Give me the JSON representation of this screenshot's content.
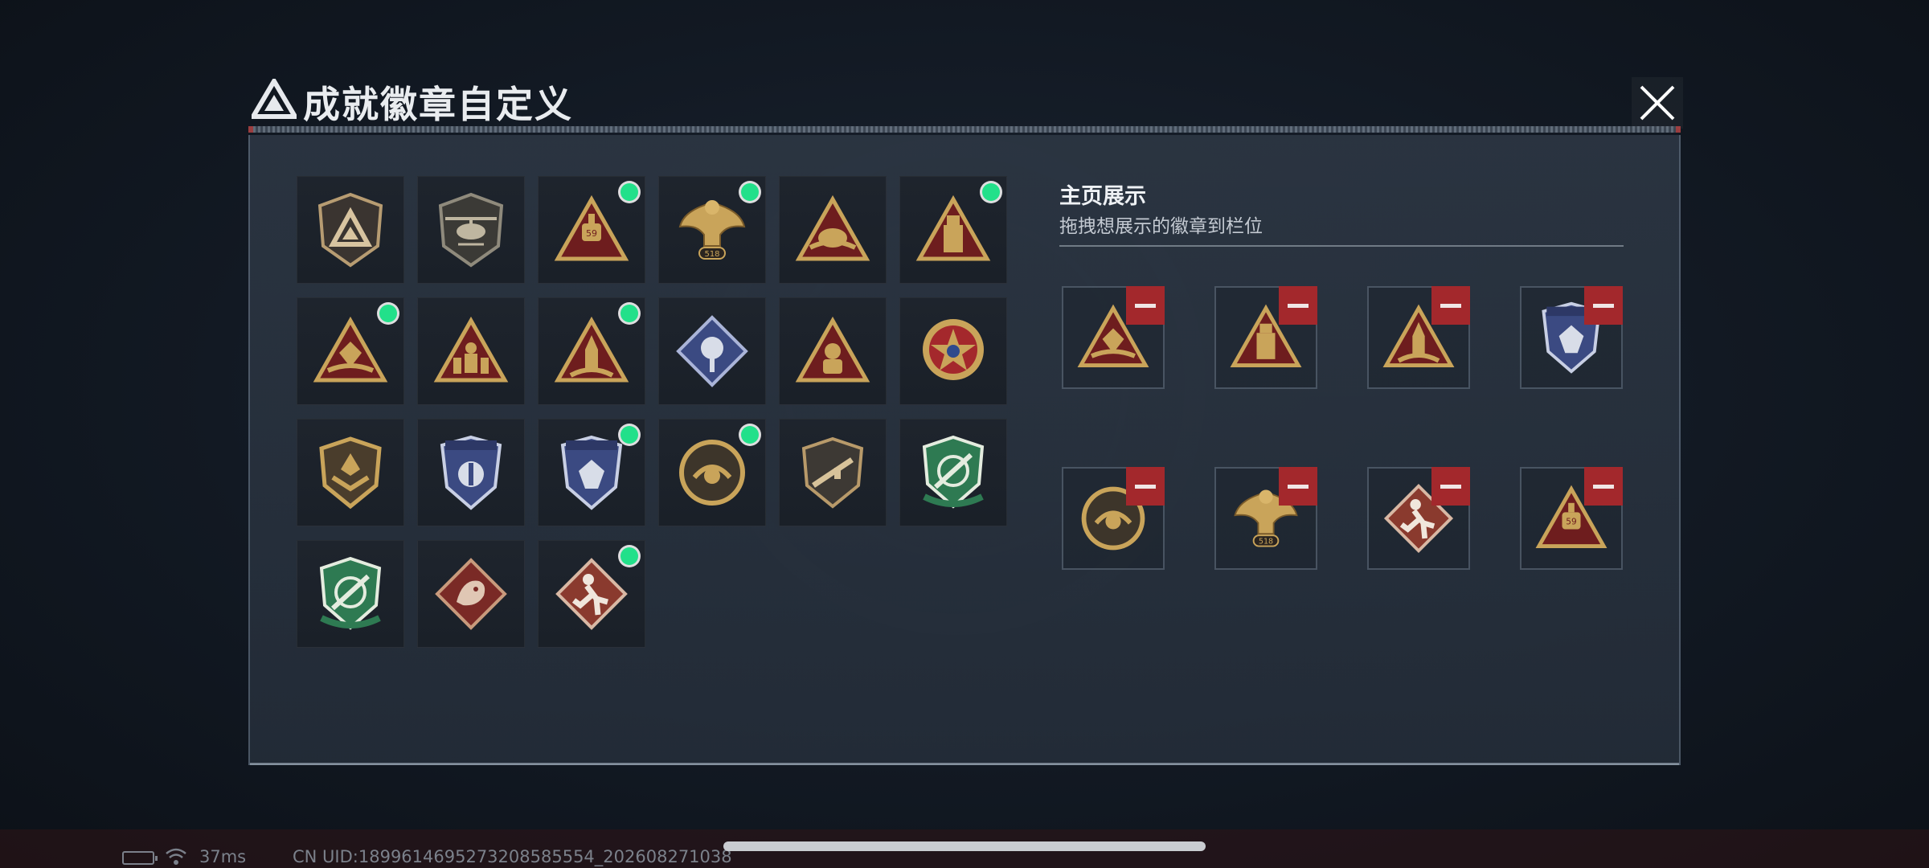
{
  "dialog": {
    "title": "成就徽章自定义",
    "logo_icon": "triangle-logo-icon",
    "close_icon": "close-icon"
  },
  "badges": [
    {
      "icon": "shield-triangle-badge-icon",
      "is_new": false
    },
    {
      "icon": "helicopter-badge-icon",
      "is_new": false
    },
    {
      "icon": "gold-triangle-59-badge-icon",
      "is_new": true
    },
    {
      "icon": "phoenix-518-badge-icon",
      "is_new": true
    },
    {
      "icon": "gold-triangle-hands-badge-icon",
      "is_new": false
    },
    {
      "icon": "gold-triangle-usb-badge-icon",
      "is_new": true
    },
    {
      "icon": "gold-triangle-crystal-badge-icon",
      "is_new": true
    },
    {
      "icon": "gold-triangle-soldiers-badge-icon",
      "is_new": false
    },
    {
      "icon": "gold-triangle-rocket-badge-icon",
      "is_new": true
    },
    {
      "icon": "blue-diamond-rose-badge-icon",
      "is_new": false
    },
    {
      "icon": "gold-triangle-astronaut-badge-icon",
      "is_new": false
    },
    {
      "icon": "red-star-medal-badge-icon",
      "is_new": false
    },
    {
      "icon": "gold-shield-chevron-badge-icon",
      "is_new": false
    },
    {
      "icon": "blue-shield-emblem-badge-icon",
      "is_new": false
    },
    {
      "icon": "blue-shield-crystal-badge-icon",
      "is_new": true
    },
    {
      "icon": "gold-round-pearl-badge-icon",
      "is_new": true
    },
    {
      "icon": "gold-shield-rifle-badge-icon",
      "is_new": false
    },
    {
      "icon": "green-shield-sniper-badge-icon",
      "is_new": false
    },
    {
      "icon": "green-shield-knife-badge-icon",
      "is_new": false
    },
    {
      "icon": "red-diamond-dragon-badge-icon",
      "is_new": false
    },
    {
      "icon": "red-diamond-runner-badge-icon",
      "is_new": true
    }
  ],
  "showcase": {
    "title": "主页展示",
    "subtitle": "拖拽想展示的徽章到栏位",
    "slots": [
      {
        "icon": "gold-triangle-crystal-badge-icon"
      },
      {
        "icon": "gold-triangle-usb-badge-icon"
      },
      {
        "icon": "gold-triangle-rocket-badge-icon"
      },
      {
        "icon": "blue-shield-crystal-badge-icon"
      },
      {
        "icon": "gold-round-pearl-badge-icon"
      },
      {
        "icon": "phoenix-518-badge-icon"
      },
      {
        "icon": "red-diamond-runner-badge-icon"
      },
      {
        "icon": "gold-triangle-59-badge-icon"
      }
    ]
  },
  "status_bar": {
    "ping": "37ms",
    "uid": "CN UID:1899614695273208585554_202608271038"
  },
  "colors": {
    "new_dot": "#22e08a",
    "remove_button": "#a3282c",
    "gold": "#c9a45a",
    "deep_red": "#6e1d1e"
  }
}
